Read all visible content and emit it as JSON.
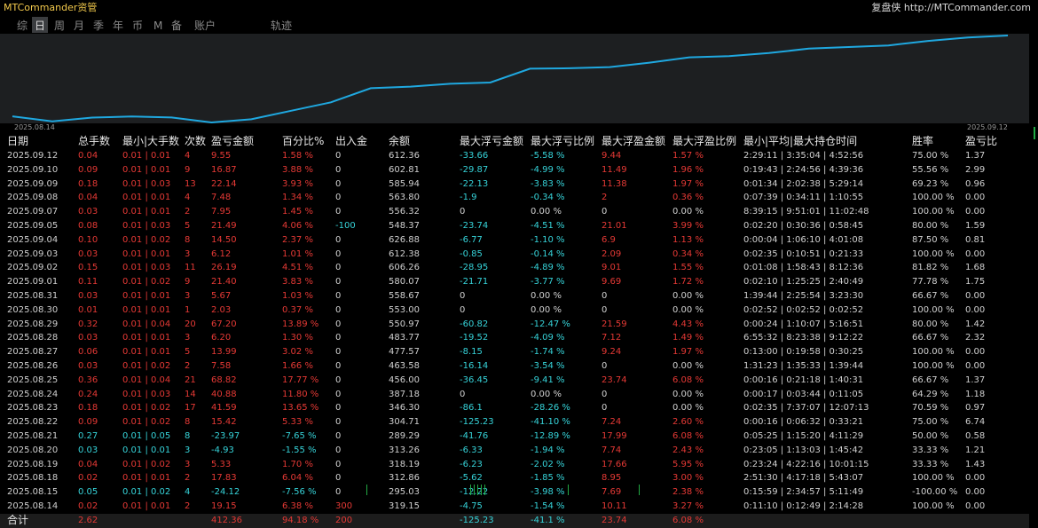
{
  "app": {
    "title": "MTCommander资管",
    "brand": "复盘侠 http://MTCommander.com"
  },
  "tabs": [
    "综",
    "日",
    "周",
    "月",
    "季",
    "年",
    "币",
    "M",
    "备",
    "账户"
  ],
  "active_tab": 1,
  "chart_title": "轨迹",
  "chart_data": {
    "type": "line",
    "title": "轨迹",
    "x": [
      "2025.08.14",
      "2025.08.15",
      "2025.08.18",
      "2025.08.19",
      "2025.08.20",
      "2025.08.21",
      "2025.08.22",
      "2025.08.23",
      "2025.08.24",
      "2025.08.25",
      "2025.08.26",
      "2025.08.27",
      "2025.08.28",
      "2025.08.29",
      "2025.08.30",
      "2025.08.31",
      "2025.09.01",
      "2025.09.02",
      "2025.09.03",
      "2025.09.04",
      "2025.09.05",
      "2025.09.07",
      "2025.09.08",
      "2025.09.09",
      "2025.09.10",
      "2025.09.12"
    ],
    "values": [
      19.15,
      -4.97,
      12.86,
      18.19,
      13.26,
      -10.71,
      4.71,
      46.3,
      87.18,
      156.0,
      163.58,
      177.57,
      183.77,
      250.97,
      253.0,
      258.67,
      280.07,
      306.26,
      312.38,
      326.88,
      348.37,
      356.32,
      363.8,
      385.94,
      402.81,
      412.36
    ],
    "series_color": "#1fa8e0",
    "start_label": "2025.08.14",
    "end_label": "2025.09.12"
  },
  "columns": [
    "日期",
    "总手数",
    "最小|大手数",
    "次数",
    "盈亏金额",
    "百分比%",
    "出入金",
    "余额",
    "最大浮亏金额",
    "最大浮亏比例",
    "最大浮盈金额",
    "最大浮盈比例",
    "最小|平均|最大持仓时间",
    "胜率",
    "盈亏比"
  ],
  "rows": [
    {
      "date": "2025.09.12",
      "lots": "0.04",
      "minmax": "0.01 | 0.01",
      "count": "4",
      "pnl": "9.55",
      "pct": "1.58 %",
      "flow": "0",
      "bal": "612.36",
      "mfl": "-33.66",
      "mflp": "-5.58 %",
      "mfp": "9.44",
      "mfpp": "1.57 %",
      "time": "2:29:11 | 3:35:04 | 4:52:56",
      "win": "75.00 %",
      "pr": "1.37",
      "neg": false
    },
    {
      "date": "2025.09.10",
      "lots": "0.09",
      "minmax": "0.01 | 0.01",
      "count": "9",
      "pnl": "16.87",
      "pct": "3.88 %",
      "flow": "0",
      "bal": "602.81",
      "mfl": "-29.87",
      "mflp": "-4.99 %",
      "mfp": "11.49",
      "mfpp": "1.96 %",
      "time": "0:19:43 | 2:24:56 | 4:39:36",
      "win": "55.56 %",
      "pr": "2.99",
      "neg": false
    },
    {
      "date": "2025.09.09",
      "lots": "0.18",
      "minmax": "0.01 | 0.03",
      "count": "13",
      "pnl": "22.14",
      "pct": "3.93 %",
      "flow": "0",
      "bal": "585.94",
      "mfl": "-22.13",
      "mflp": "-3.83 %",
      "mfp": "11.38",
      "mfpp": "1.97 %",
      "time": "0:01:34 | 2:02:38 | 5:29:14",
      "win": "69.23 %",
      "pr": "0.96",
      "neg": false
    },
    {
      "date": "2025.09.08",
      "lots": "0.04",
      "minmax": "0.01 | 0.01",
      "count": "4",
      "pnl": "7.48",
      "pct": "1.34 %",
      "flow": "0",
      "bal": "563.80",
      "mfl": "-1.9",
      "mflp": "-0.34 %",
      "mfp": "2",
      "mfpp": "0.36 %",
      "time": "0:07:39 | 0:34:11 | 1:10:55",
      "win": "100.00 %",
      "pr": "0.00",
      "neg": false
    },
    {
      "date": "2025.09.07",
      "lots": "0.03",
      "minmax": "0.01 | 0.01",
      "count": "2",
      "pnl": "7.95",
      "pct": "1.45 %",
      "flow": "0",
      "bal": "556.32",
      "mfl": "0",
      "mflp": "0.00 %",
      "mfp": "0",
      "mfpp": "0.00 %",
      "time": "8:39:15 | 9:51:01 | 11:02:48",
      "win": "100.00 %",
      "pr": "0.00",
      "neg": false
    },
    {
      "date": "2025.09.05",
      "lots": "0.08",
      "minmax": "0.01 | 0.03",
      "count": "5",
      "pnl": "21.49",
      "pct": "4.06 %",
      "flow": "-100",
      "bal": "548.37",
      "mfl": "-23.74",
      "mflp": "-4.51 %",
      "mfp": "21.01",
      "mfpp": "3.99 %",
      "time": "0:02:20 | 0:30:36 | 0:58:45",
      "win": "80.00 %",
      "pr": "1.59",
      "neg": false
    },
    {
      "date": "2025.09.04",
      "lots": "0.10",
      "minmax": "0.01 | 0.02",
      "count": "8",
      "pnl": "14.50",
      "pct": "2.37 %",
      "flow": "0",
      "bal": "626.88",
      "mfl": "-6.77",
      "mflp": "-1.10 %",
      "mfp": "6.9",
      "mfpp": "1.13 %",
      "time": "0:00:04 | 1:06:10 | 4:01:08",
      "win": "87.50 %",
      "pr": "0.81",
      "neg": false
    },
    {
      "date": "2025.09.03",
      "lots": "0.03",
      "minmax": "0.01 | 0.01",
      "count": "3",
      "pnl": "6.12",
      "pct": "1.01 %",
      "flow": "0",
      "bal": "612.38",
      "mfl": "-0.85",
      "mflp": "-0.14 %",
      "mfp": "2.09",
      "mfpp": "0.34 %",
      "time": "0:02:35 | 0:10:51 | 0:21:33",
      "win": "100.00 %",
      "pr": "0.00",
      "neg": false
    },
    {
      "date": "2025.09.02",
      "lots": "0.15",
      "minmax": "0.01 | 0.03",
      "count": "11",
      "pnl": "26.19",
      "pct": "4.51 %",
      "flow": "0",
      "bal": "606.26",
      "mfl": "-28.95",
      "mflp": "-4.89 %",
      "mfp": "9.01",
      "mfpp": "1.55 %",
      "time": "0:01:08 | 1:58:43 | 8:12:36",
      "win": "81.82 %",
      "pr": "1.68",
      "neg": false
    },
    {
      "date": "2025.09.01",
      "lots": "0.11",
      "minmax": "0.01 | 0.02",
      "count": "9",
      "pnl": "21.40",
      "pct": "3.83 %",
      "flow": "0",
      "bal": "580.07",
      "mfl": "-21.71",
      "mflp": "-3.77 %",
      "mfp": "9.69",
      "mfpp": "1.72 %",
      "time": "0:02:10 | 1:25:25 | 2:40:49",
      "win": "77.78 %",
      "pr": "1.75",
      "neg": false
    },
    {
      "date": "2025.08.31",
      "lots": "0.03",
      "minmax": "0.01 | 0.01",
      "count": "3",
      "pnl": "5.67",
      "pct": "1.03 %",
      "flow": "0",
      "bal": "558.67",
      "mfl": "0",
      "mflp": "0.00 %",
      "mfp": "0",
      "mfpp": "0.00 %",
      "time": "1:39:44 | 2:25:54 | 3:23:30",
      "win": "66.67 %",
      "pr": "0.00",
      "neg": false
    },
    {
      "date": "2025.08.30",
      "lots": "0.01",
      "minmax": "0.01 | 0.01",
      "count": "1",
      "pnl": "2.03",
      "pct": "0.37 %",
      "flow": "0",
      "bal": "553.00",
      "mfl": "0",
      "mflp": "0.00 %",
      "mfp": "0",
      "mfpp": "0.00 %",
      "time": "0:02:52 | 0:02:52 | 0:02:52",
      "win": "100.00 %",
      "pr": "0.00",
      "neg": false
    },
    {
      "date": "2025.08.29",
      "lots": "0.32",
      "minmax": "0.01 | 0.04",
      "count": "20",
      "pnl": "67.20",
      "pct": "13.89 %",
      "flow": "0",
      "bal": "550.97",
      "mfl": "-60.82",
      "mflp": "-12.47 %",
      "mfp": "21.59",
      "mfpp": "4.43 %",
      "time": "0:00:24 | 1:10:07 | 5:16:51",
      "win": "80.00 %",
      "pr": "1.42",
      "neg": false
    },
    {
      "date": "2025.08.28",
      "lots": "0.03",
      "minmax": "0.01 | 0.01",
      "count": "3",
      "pnl": "6.20",
      "pct": "1.30 %",
      "flow": "0",
      "bal": "483.77",
      "mfl": "-19.52",
      "mflp": "-4.09 %",
      "mfp": "7.12",
      "mfpp": "1.49 %",
      "time": "6:55:32 | 8:23:38 | 9:12:22",
      "win": "66.67 %",
      "pr": "2.32",
      "neg": false
    },
    {
      "date": "2025.08.27",
      "lots": "0.06",
      "minmax": "0.01 | 0.01",
      "count": "5",
      "pnl": "13.99",
      "pct": "3.02 %",
      "flow": "0",
      "bal": "477.57",
      "mfl": "-8.15",
      "mflp": "-1.74 %",
      "mfp": "9.24",
      "mfpp": "1.97 %",
      "time": "0:13:00 | 0:19:58 | 0:30:25",
      "win": "100.00 %",
      "pr": "0.00",
      "neg": false
    },
    {
      "date": "2025.08.26",
      "lots": "0.03",
      "minmax": "0.01 | 0.02",
      "count": "2",
      "pnl": "7.58",
      "pct": "1.66 %",
      "flow": "0",
      "bal": "463.58",
      "mfl": "-16.14",
      "mflp": "-3.54 %",
      "mfp": "0",
      "mfpp": "0.00 %",
      "time": "1:31:23 | 1:35:33 | 1:39:44",
      "win": "100.00 %",
      "pr": "0.00",
      "neg": false
    },
    {
      "date": "2025.08.25",
      "lots": "0.36",
      "minmax": "0.01 | 0.04",
      "count": "21",
      "pnl": "68.82",
      "pct": "17.77 %",
      "flow": "0",
      "bal": "456.00",
      "mfl": "-36.45",
      "mflp": "-9.41 %",
      "mfp": "23.74",
      "mfpp": "6.08 %",
      "time": "0:00:16 | 0:21:18 | 1:40:31",
      "win": "66.67 %",
      "pr": "1.37",
      "neg": false
    },
    {
      "date": "2025.08.24",
      "lots": "0.24",
      "minmax": "0.01 | 0.03",
      "count": "14",
      "pnl": "40.88",
      "pct": "11.80 %",
      "flow": "0",
      "bal": "387.18",
      "mfl": "0",
      "mflp": "0.00 %",
      "mfp": "0",
      "mfpp": "0.00 %",
      "time": "0:00:17 | 0:03:44 | 0:11:05",
      "win": "64.29 %",
      "pr": "1.18",
      "neg": false
    },
    {
      "date": "2025.08.23",
      "lots": "0.18",
      "minmax": "0.01 | 0.02",
      "count": "17",
      "pnl": "41.59",
      "pct": "13.65 %",
      "flow": "0",
      "bal": "346.30",
      "mfl": "-86.1",
      "mflp": "-28.26 %",
      "mfp": "0",
      "mfpp": "0.00 %",
      "time": "0:02:35 | 7:37:07 | 12:07:13",
      "win": "70.59 %",
      "pr": "0.97",
      "neg": false
    },
    {
      "date": "2025.08.22",
      "lots": "0.09",
      "minmax": "0.01 | 0.02",
      "count": "8",
      "pnl": "15.42",
      "pct": "5.33 %",
      "flow": "0",
      "bal": "304.71",
      "mfl": "-125.23",
      "mflp": "-41.10 %",
      "mfp": "7.24",
      "mfpp": "2.60 %",
      "time": "0:00:16 | 0:06:32 | 0:33:21",
      "win": "75.00 %",
      "pr": "6.74",
      "neg": false
    },
    {
      "date": "2025.08.21",
      "lots": "0.27",
      "minmax": "0.01 | 0.05",
      "count": "8",
      "pnl": "-23.97",
      "pct": "-7.65 %",
      "flow": "0",
      "bal": "289.29",
      "mfl": "-41.76",
      "mflp": "-12.89 %",
      "mfp": "17.99",
      "mfpp": "6.08 %",
      "time": "0:05:25 | 1:15:20 | 4:11:29",
      "win": "50.00 %",
      "pr": "0.58",
      "neg": true
    },
    {
      "date": "2025.08.20",
      "lots": "0.03",
      "minmax": "0.01 | 0.01",
      "count": "3",
      "pnl": "-4.93",
      "pct": "-1.55 %",
      "flow": "0",
      "bal": "313.26",
      "mfl": "-6.33",
      "mflp": "-1.94 %",
      "mfp": "7.74",
      "mfpp": "2.43 %",
      "time": "0:23:05 | 1:13:03 | 1:45:42",
      "win": "33.33 %",
      "pr": "1.21",
      "neg": true
    },
    {
      "date": "2025.08.19",
      "lots": "0.04",
      "minmax": "0.01 | 0.02",
      "count": "3",
      "pnl": "5.33",
      "pct": "1.70 %",
      "flow": "0",
      "bal": "318.19",
      "mfl": "-6.23",
      "mflp": "-2.02 %",
      "mfp": "17.66",
      "mfpp": "5.95 %",
      "time": "0:23:24 | 4:22:16 | 10:01:15",
      "win": "33.33 %",
      "pr": "1.43",
      "neg": false
    },
    {
      "date": "2025.08.18",
      "lots": "0.02",
      "minmax": "0.01 | 0.01",
      "count": "2",
      "pnl": "17.83",
      "pct": "6.04 %",
      "flow": "0",
      "bal": "312.86",
      "mfl": "-5.62",
      "mflp": "-1.85 %",
      "mfp": "8.95",
      "mfpp": "3.00 %",
      "time": "2:51:30 | 4:17:18 | 5:43:07",
      "win": "100.00 %",
      "pr": "0.00",
      "neg": false
    },
    {
      "date": "2025.08.15",
      "lots": "0.05",
      "minmax": "0.01 | 0.02",
      "count": "4",
      "pnl": "-24.12",
      "pct": "-7.56 %",
      "flow": "0",
      "bal": "295.03",
      "mfl": "-12.22",
      "mflp": "-3.98 %",
      "mfp": "7.69",
      "mfpp": "2.38 %",
      "time": "0:15:59 | 2:34:57 | 5:11:49",
      "win": "-100.00 %",
      "pr": "0.00",
      "neg": true
    },
    {
      "date": "2025.08.14",
      "lots": "0.02",
      "minmax": "0.01 | 0.01",
      "count": "2",
      "pnl": "19.15",
      "pct": "6.38 %",
      "flow": "300",
      "bal": "319.15",
      "mfl": "-4.75",
      "mflp": "-1.54 %",
      "mfp": "10.11",
      "mfpp": "3.27 %",
      "time": "0:11:10 | 0:12:49 | 2:14:28",
      "win": "100.00 %",
      "pr": "0.00",
      "neg": false
    }
  ],
  "total": {
    "label": "合计",
    "lots": "2.62",
    "pnl": "412.36",
    "pct": "94.18 %",
    "flow": "200",
    "mfl": "-125.23",
    "mflp": "-41.1 %",
    "mfp": "23.74",
    "mfpp": "6.08 %"
  },
  "colors": {
    "positive": "#e53935",
    "negative": "#36d3d9",
    "neutral": "#d0d0d0",
    "header": "#e6e6e6",
    "line": "#1fa8e0"
  }
}
